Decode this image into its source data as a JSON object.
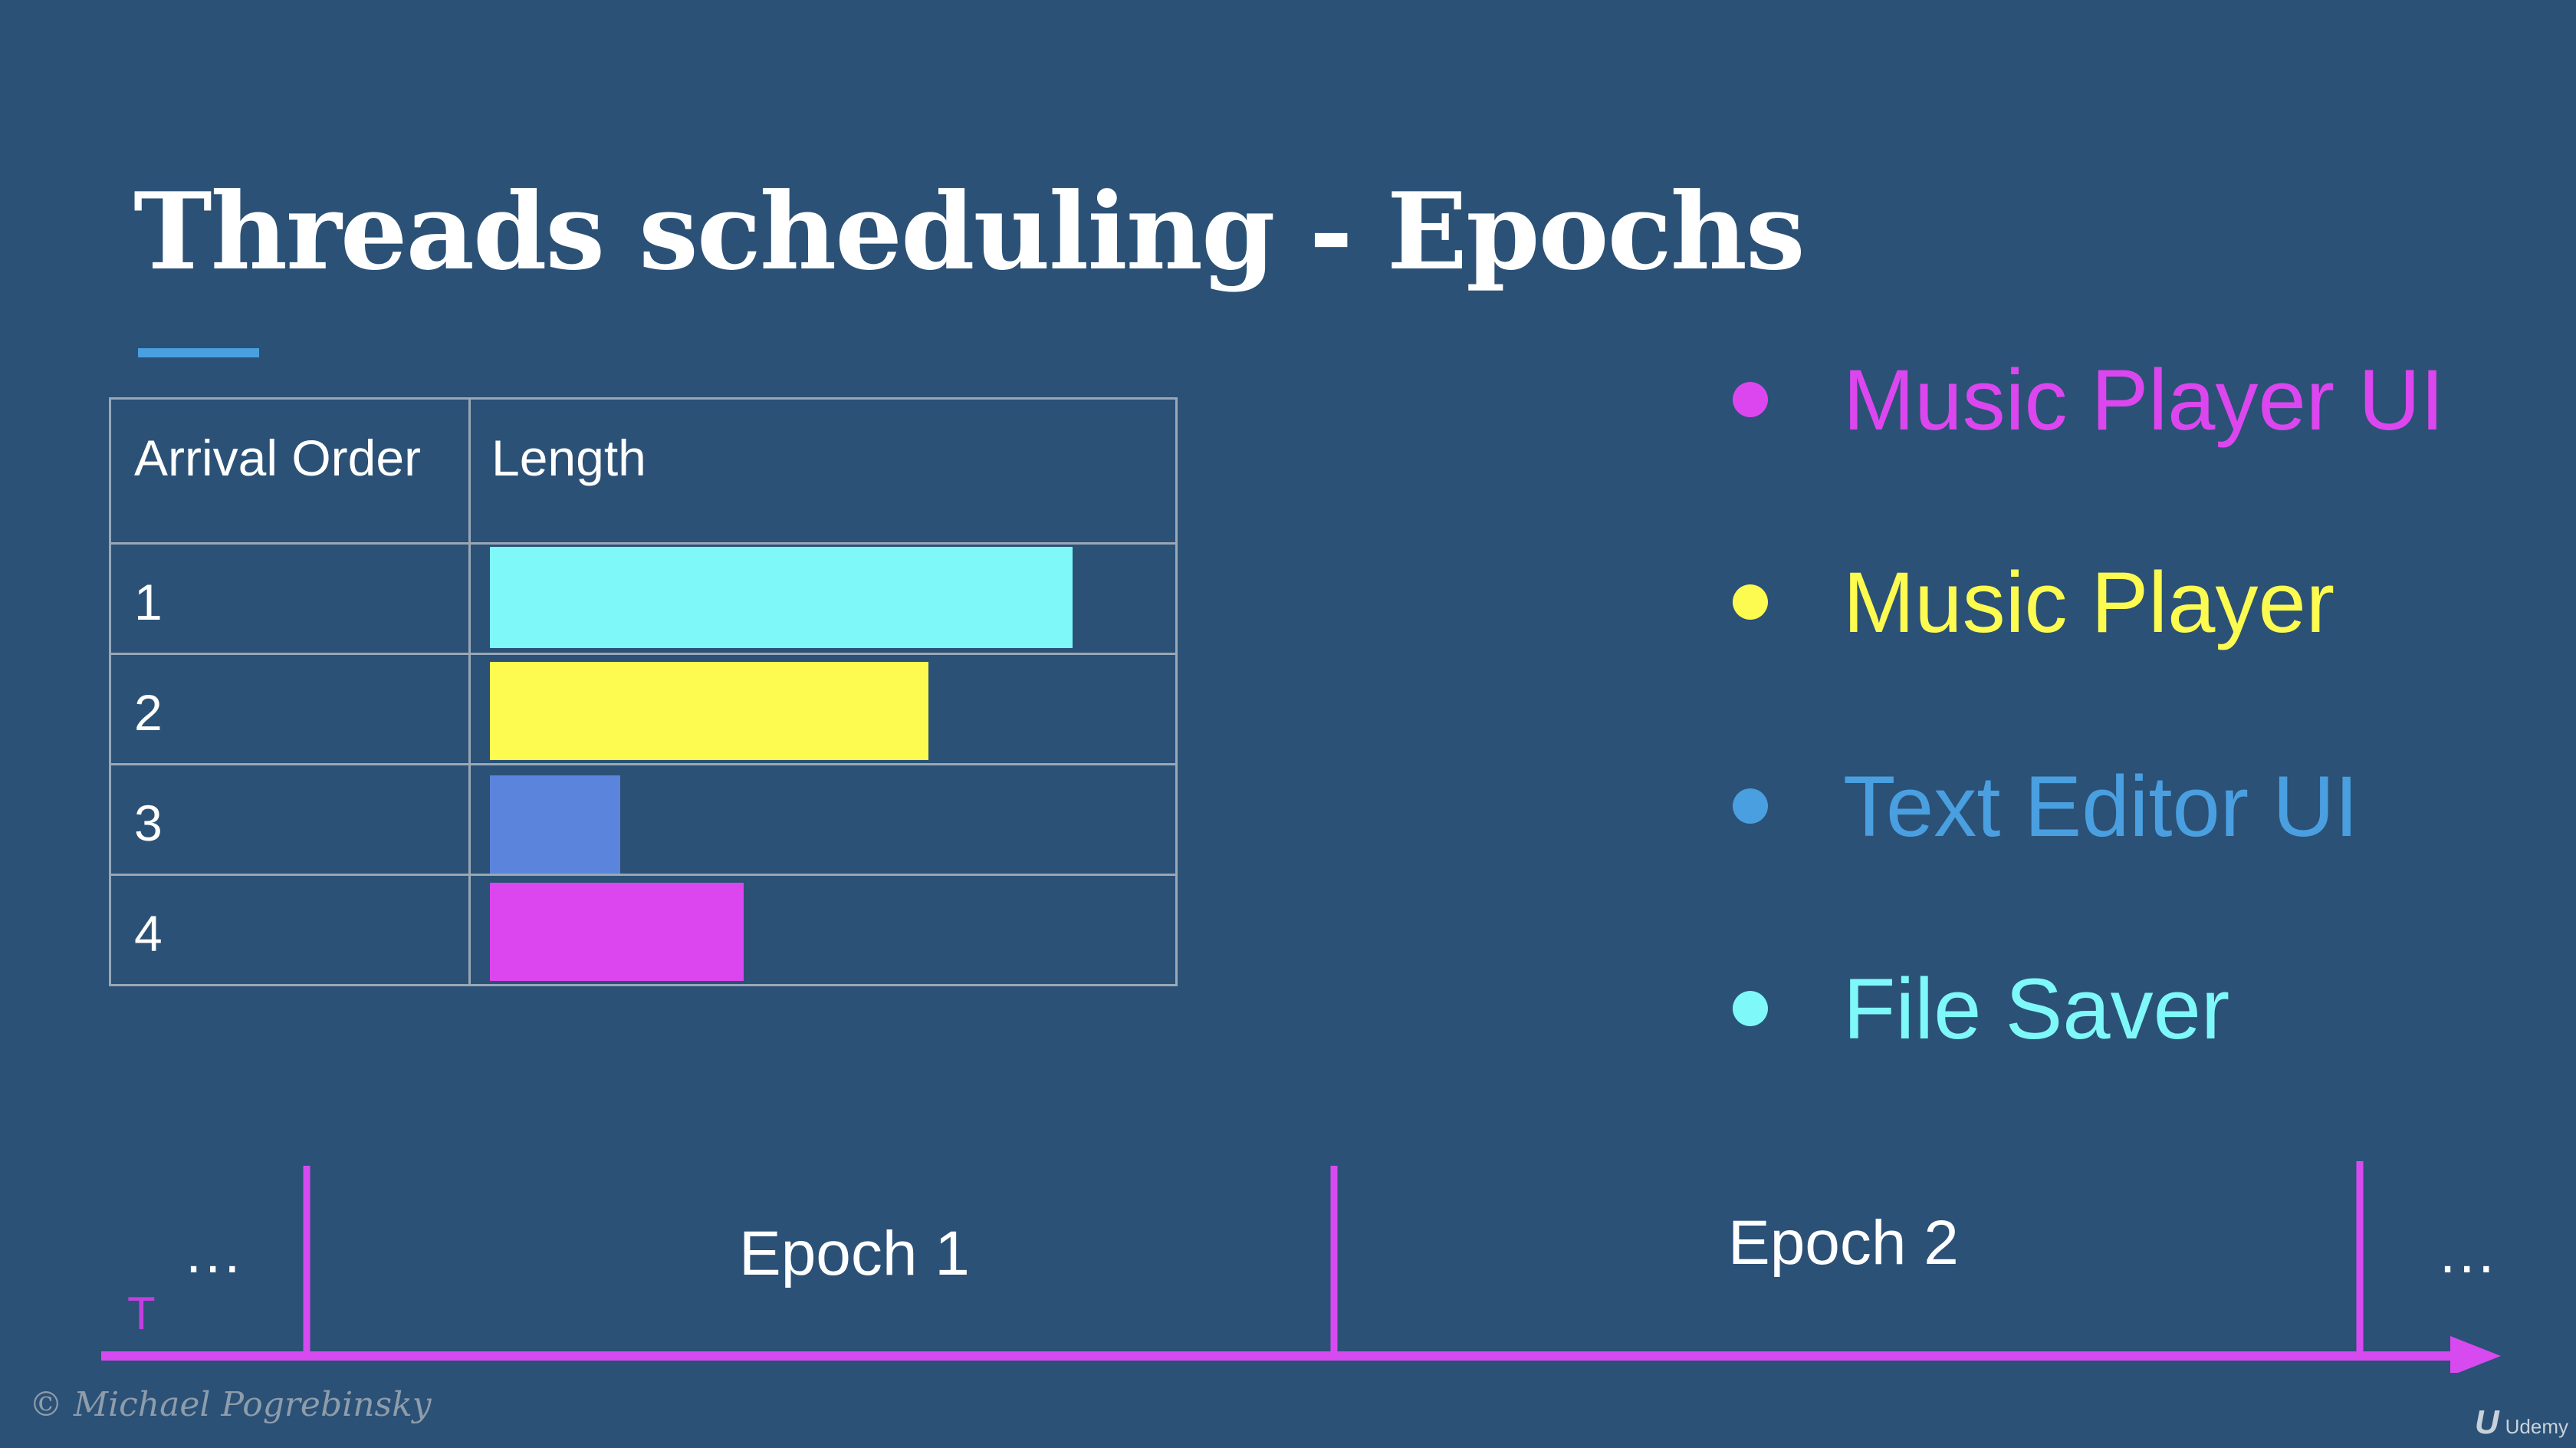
{
  "slide": {
    "title": "Threads scheduling - Epochs"
  },
  "table": {
    "headers": [
      "Arrival Order",
      "Length"
    ],
    "rows": [
      {
        "order": "1",
        "length": 0.85,
        "color": "#7ef8f8"
      },
      {
        "order": "2",
        "length": 0.64,
        "color": "#fdfb4f"
      },
      {
        "order": "3",
        "length": 0.19,
        "color": "#5b84dc"
      },
      {
        "order": "4",
        "length": 0.37,
        "color": "#dc46ee"
      }
    ]
  },
  "legend": {
    "items": [
      {
        "label": "Music Player UI",
        "color": "#dc46ee"
      },
      {
        "label": "Music Player",
        "color": "#fdfb4f"
      },
      {
        "label": "Text Editor UI",
        "color": "#4a9fe0"
      },
      {
        "label": "File Saver",
        "color": "#7ef8f8"
      }
    ]
  },
  "timeline": {
    "axis_label": "T",
    "leading_ellipsis": "...",
    "trailing_ellipsis": "...",
    "epochs": [
      "Epoch 1",
      "Epoch 2"
    ],
    "line_color": "#d74af0"
  },
  "footer": {
    "copyright": "© Michael Pogrebinsky",
    "brand": "Udemy",
    "brand_mark": "U"
  }
}
